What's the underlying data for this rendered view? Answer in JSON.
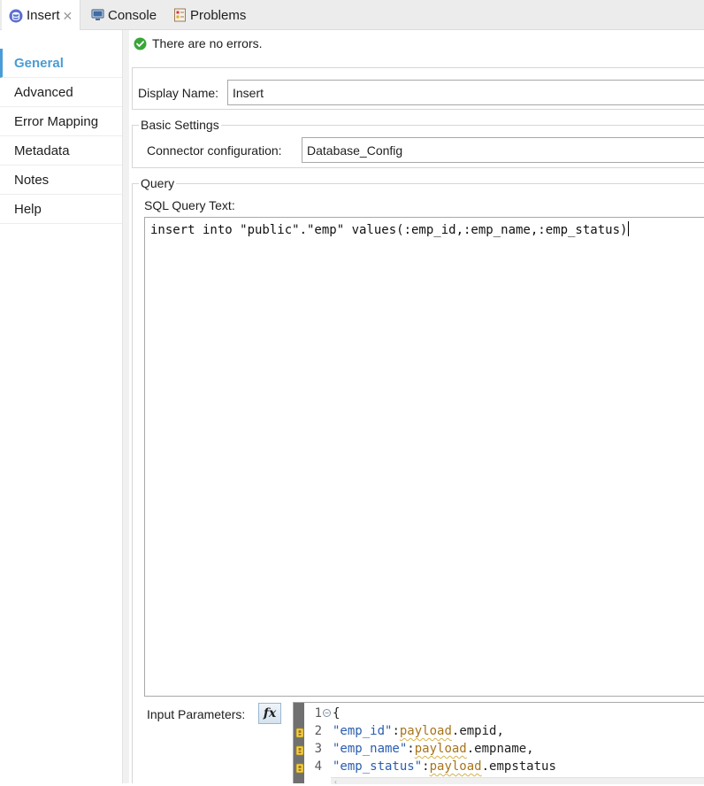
{
  "tabs": [
    {
      "label": "Insert",
      "icon": "database-icon",
      "active": true
    },
    {
      "label": "Console",
      "icon": "console-icon"
    },
    {
      "label": "Problems",
      "icon": "problems-icon"
    }
  ],
  "tab_close_glyph": "✕",
  "nav": {
    "items": [
      {
        "label": "General",
        "active": true
      },
      {
        "label": "Advanced"
      },
      {
        "label": "Error Mapping"
      },
      {
        "label": "Metadata"
      },
      {
        "label": "Notes"
      },
      {
        "label": "Help"
      }
    ]
  },
  "status": {
    "message": "There are no errors.",
    "icon": "check-circle-icon"
  },
  "general": {
    "display_name_label": "Display Name:",
    "display_name_value": "Insert"
  },
  "basic_settings": {
    "title": "Basic Settings",
    "connector_label": "Connector configuration:",
    "connector_value": "Database_Config"
  },
  "query": {
    "title": "Query",
    "sql_label": "SQL Query Text:",
    "sql_text": "insert into \"public\".\"emp\" values(:emp_id,:emp_name,:emp_status)",
    "input_params_label": "Input Parameters:",
    "fx_label": "fx",
    "input_params_code": [
      {
        "num": "1",
        "tokens": [
          {
            "t": "{",
            "c": "p"
          }
        ],
        "fold": true
      },
      {
        "num": "2",
        "tokens": [
          {
            "t": "\"emp_id\"",
            "c": "k"
          },
          {
            "t": ":",
            "c": "p"
          },
          {
            "t": "payload",
            "c": "v"
          },
          {
            "t": ".empid,",
            "c": "p"
          }
        ],
        "marker": true
      },
      {
        "num": "3",
        "tokens": [
          {
            "t": "\"emp_name\"",
            "c": "k"
          },
          {
            "t": ":",
            "c": "p"
          },
          {
            "t": "payload",
            "c": "v"
          },
          {
            "t": ".empname,",
            "c": "p"
          }
        ],
        "marker": true
      },
      {
        "num": "4",
        "tokens": [
          {
            "t": "\"emp_status\"",
            "c": "k"
          },
          {
            "t": ":",
            "c": "p"
          },
          {
            "t": "payload",
            "c": "v"
          },
          {
            "t": ".empstatus",
            "c": "p"
          }
        ],
        "marker": true
      }
    ]
  },
  "colors": {
    "accent": "#4a9cd6",
    "success": "#3aa53a",
    "json_key": "#2a5db0",
    "json_value": "#a8741a"
  }
}
